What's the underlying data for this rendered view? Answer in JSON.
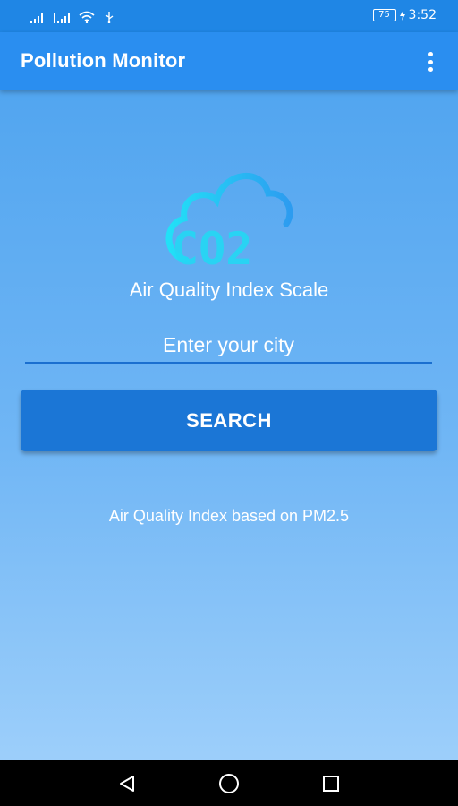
{
  "status_bar": {
    "battery_level": "75",
    "time": "3:52"
  },
  "app_bar": {
    "title": "Pollution Monitor",
    "menu_icon": "overflow-menu-icon"
  },
  "logo": {
    "icon": "cloud-co2-icon",
    "text": "CO2"
  },
  "main": {
    "scale_label": "Air Quality Index Scale",
    "city_input": {
      "value": "",
      "placeholder": "Enter your city"
    },
    "search_label": "SEARCH",
    "info_text": "Air Quality Index based on PM2.5"
  },
  "nav_bar": {
    "back_icon": "back-icon",
    "home_icon": "home-icon",
    "recents_icon": "recents-icon"
  },
  "colors": {
    "status_bar": "#1f86e5",
    "app_bar": "#2a8ef0",
    "button": "#1b76d6",
    "logo_cyan": "#2fd6f5"
  }
}
